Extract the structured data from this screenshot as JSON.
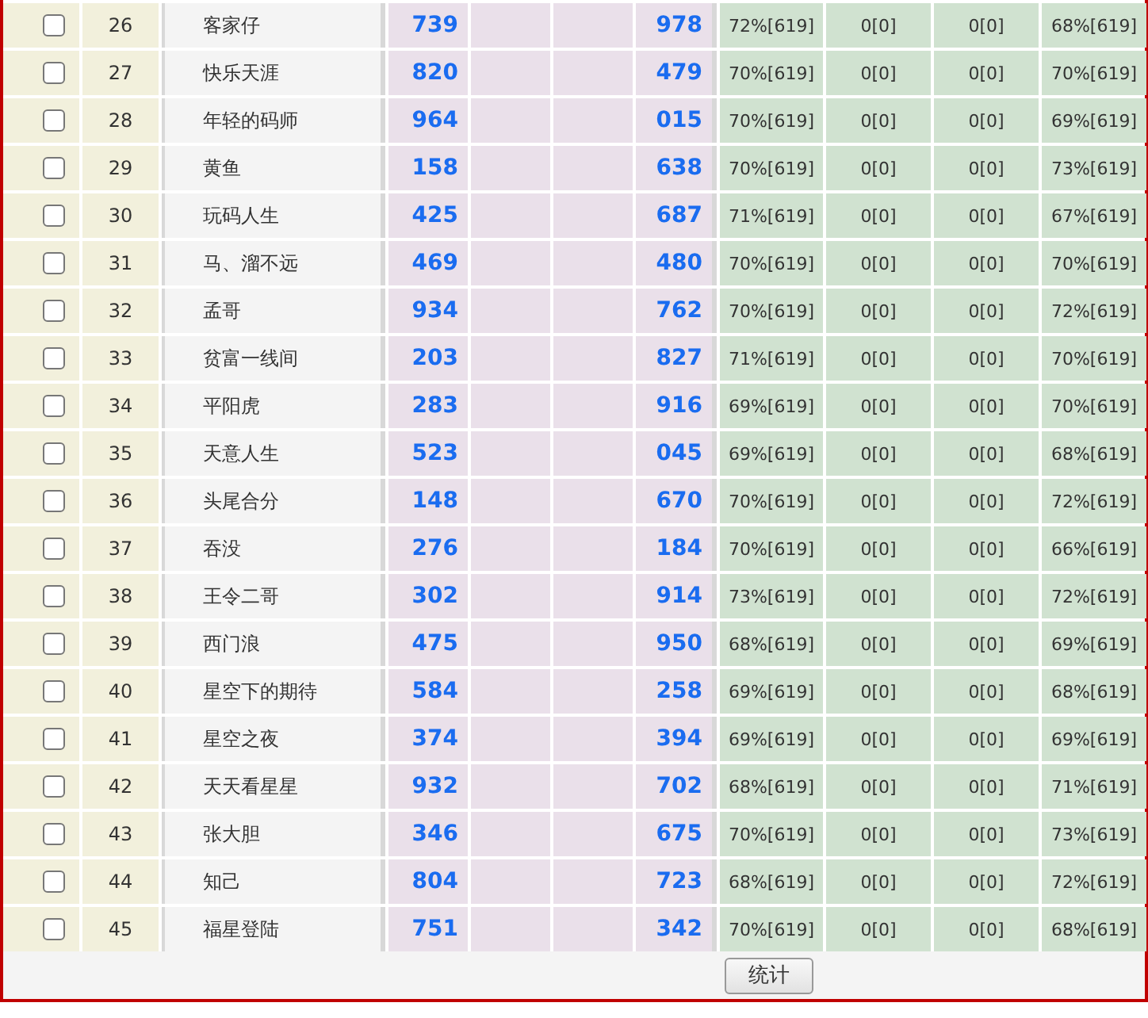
{
  "rows": [
    {
      "checked": false,
      "no": "26",
      "name": "客家仔",
      "value_1": "739",
      "value_2": "978",
      "rate_1": "72%[619]",
      "rate_2": "0[0]",
      "rate_3": "0[0]",
      "rate_4": "68%[619]"
    },
    {
      "checked": false,
      "no": "27",
      "name": "快乐天涯",
      "value_1": "820",
      "value_2": "479",
      "rate_1": "70%[619]",
      "rate_2": "0[0]",
      "rate_3": "0[0]",
      "rate_4": "70%[619]"
    },
    {
      "checked": false,
      "no": "28",
      "name": "年轻的码师",
      "value_1": "964",
      "value_2": "015",
      "rate_1": "70%[619]",
      "rate_2": "0[0]",
      "rate_3": "0[0]",
      "rate_4": "69%[619]"
    },
    {
      "checked": false,
      "no": "29",
      "name": "黄鱼",
      "value_1": "158",
      "value_2": "638",
      "rate_1": "70%[619]",
      "rate_2": "0[0]",
      "rate_3": "0[0]",
      "rate_4": "73%[619]"
    },
    {
      "checked": false,
      "no": "30",
      "name": "玩码人生",
      "value_1": "425",
      "value_2": "687",
      "rate_1": "71%[619]",
      "rate_2": "0[0]",
      "rate_3": "0[0]",
      "rate_4": "67%[619]"
    },
    {
      "checked": false,
      "no": "31",
      "name": "马、溜不远",
      "value_1": "469",
      "value_2": "480",
      "rate_1": "70%[619]",
      "rate_2": "0[0]",
      "rate_3": "0[0]",
      "rate_4": "70%[619]"
    },
    {
      "checked": false,
      "no": "32",
      "name": "孟哥",
      "value_1": "934",
      "value_2": "762",
      "rate_1": "70%[619]",
      "rate_2": "0[0]",
      "rate_3": "0[0]",
      "rate_4": "72%[619]"
    },
    {
      "checked": false,
      "no": "33",
      "name": "贫富一线间",
      "value_1": "203",
      "value_2": "827",
      "rate_1": "71%[619]",
      "rate_2": "0[0]",
      "rate_3": "0[0]",
      "rate_4": "70%[619]"
    },
    {
      "checked": false,
      "no": "34",
      "name": "平阳虎",
      "value_1": "283",
      "value_2": "916",
      "rate_1": "69%[619]",
      "rate_2": "0[0]",
      "rate_3": "0[0]",
      "rate_4": "70%[619]"
    },
    {
      "checked": false,
      "no": "35",
      "name": "天意人生",
      "value_1": "523",
      "value_2": "045",
      "rate_1": "69%[619]",
      "rate_2": "0[0]",
      "rate_3": "0[0]",
      "rate_4": "68%[619]"
    },
    {
      "checked": false,
      "no": "36",
      "name": "头尾合分",
      "value_1": "148",
      "value_2": "670",
      "rate_1": "70%[619]",
      "rate_2": "0[0]",
      "rate_3": "0[0]",
      "rate_4": "72%[619]"
    },
    {
      "checked": false,
      "no": "37",
      "name": "吞没",
      "value_1": "276",
      "value_2": "184",
      "rate_1": "70%[619]",
      "rate_2": "0[0]",
      "rate_3": "0[0]",
      "rate_4": "66%[619]"
    },
    {
      "checked": false,
      "no": "38",
      "name": "王令二哥",
      "value_1": "302",
      "value_2": "914",
      "rate_1": "73%[619]",
      "rate_2": "0[0]",
      "rate_3": "0[0]",
      "rate_4": "72%[619]"
    },
    {
      "checked": false,
      "no": "39",
      "name": "西门浪",
      "value_1": "475",
      "value_2": "950",
      "rate_1": "68%[619]",
      "rate_2": "0[0]",
      "rate_3": "0[0]",
      "rate_4": "69%[619]"
    },
    {
      "checked": false,
      "no": "40",
      "name": "星空下的期待",
      "value_1": "584",
      "value_2": "258",
      "rate_1": "69%[619]",
      "rate_2": "0[0]",
      "rate_3": "0[0]",
      "rate_4": "68%[619]"
    },
    {
      "checked": false,
      "no": "41",
      "name": "星空之夜",
      "value_1": "374",
      "value_2": "394",
      "rate_1": "69%[619]",
      "rate_2": "0[0]",
      "rate_3": "0[0]",
      "rate_4": "69%[619]"
    },
    {
      "checked": false,
      "no": "42",
      "name": "天天看星星",
      "value_1": "932",
      "value_2": "702",
      "rate_1": "68%[619]",
      "rate_2": "0[0]",
      "rate_3": "0[0]",
      "rate_4": "71%[619]"
    },
    {
      "checked": false,
      "no": "43",
      "name": "张大胆",
      "value_1": "346",
      "value_2": "675",
      "rate_1": "70%[619]",
      "rate_2": "0[0]",
      "rate_3": "0[0]",
      "rate_4": "73%[619]"
    },
    {
      "checked": false,
      "no": "44",
      "name": "知己",
      "value_1": "804",
      "value_2": "723",
      "rate_1": "68%[619]",
      "rate_2": "0[0]",
      "rate_3": "0[0]",
      "rate_4": "72%[619]"
    },
    {
      "checked": false,
      "no": "45",
      "name": "福星登陆",
      "value_1": "751",
      "value_2": "342",
      "rate_1": "70%[619]",
      "rate_2": "0[0]",
      "rate_3": "0[0]",
      "rate_4": "68%[619]"
    }
  ],
  "footer": {
    "button": "统计"
  }
}
